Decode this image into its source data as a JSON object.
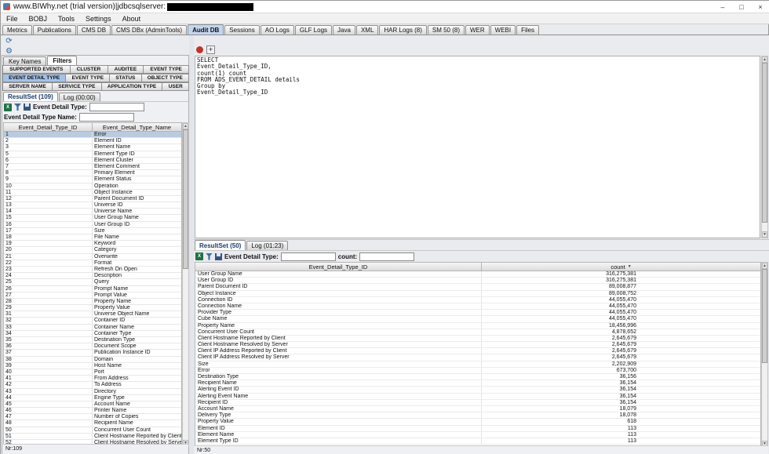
{
  "window": {
    "title": "www.BIWhy.net (trial version)|jdbcsqlserver:",
    "status_hidden": "redacted"
  },
  "icons": {
    "minimize": "–",
    "maximize": "□",
    "close": "×",
    "refresh": "⟳",
    "settings": "⚙",
    "add": "+",
    "excel": "X",
    "scroll_up": "▲",
    "scroll_down": "▼",
    "sort_desc": "▼"
  },
  "menu": {
    "items": [
      {
        "label": "File"
      },
      {
        "label": "BOBJ"
      },
      {
        "label": "Tools"
      },
      {
        "label": "Settings"
      },
      {
        "label": "About"
      }
    ]
  },
  "main_tabs": {
    "items": [
      {
        "label": "Metrics"
      },
      {
        "label": "Publications"
      },
      {
        "label": "CMS DB"
      },
      {
        "label": "CMS DBx (AdminTools)"
      },
      {
        "label": "Audit DB",
        "selected": true
      },
      {
        "label": "Sessions"
      },
      {
        "label": "AO Logs"
      },
      {
        "label": "GLF Logs"
      },
      {
        "label": "Java"
      },
      {
        "label": "XML"
      },
      {
        "label": "HAR Logs (8)"
      },
      {
        "label": "SM 50 (8)"
      },
      {
        "label": "WER"
      },
      {
        "label": "WEBI"
      },
      {
        "label": "Files"
      }
    ]
  },
  "left_panel": {
    "tabs": [
      {
        "label": "Key Names"
      },
      {
        "label": "Filters",
        "selected": true
      }
    ],
    "filter_tabs_row1": [
      {
        "label": "SUPPORTED EVENTS"
      },
      {
        "label": "CLUSTER"
      },
      {
        "label": "AUDITEE"
      },
      {
        "label": "EVENT TYPE"
      }
    ],
    "filter_tabs_row2": [
      {
        "label": "EVENT DETAIL TYPE",
        "selected": true
      },
      {
        "label": "EVENT TYPE"
      },
      {
        "label": "STATUS"
      },
      {
        "label": "OBJECT TYPE"
      }
    ],
    "filter_tabs_row3": [
      {
        "label": "SERVER NAME"
      },
      {
        "label": "SERVICE TYPE"
      },
      {
        "label": "APPLICATION TYPE"
      },
      {
        "label": "USER"
      }
    ],
    "result_tabs": [
      {
        "label": "ResultSet (109)",
        "selected": true
      },
      {
        "label": "Log (00:00)"
      }
    ],
    "filter_label": "Event Detail Type:",
    "filter_value": "",
    "name_label": "Event Detail Type Name:",
    "name_value": "",
    "table": {
      "col1": "Event_Detail_Type_ID",
      "col2": "Event_Detail_Type_Name",
      "selected_row": 0,
      "rows": [
        [
          "1",
          "Error"
        ],
        [
          "2",
          "Element ID"
        ],
        [
          "3",
          "Element Name"
        ],
        [
          "5",
          "Element Type ID"
        ],
        [
          "6",
          "Element Cluster"
        ],
        [
          "7",
          "Element Comment"
        ],
        [
          "8",
          "Primary Element"
        ],
        [
          "9",
          "Element Status"
        ],
        [
          "10",
          "Operation"
        ],
        [
          "11",
          "Object Instance"
        ],
        [
          "12",
          "Parent Document ID"
        ],
        [
          "13",
          "Universe ID"
        ],
        [
          "14",
          "Universe Name"
        ],
        [
          "15",
          "User Group Name"
        ],
        [
          "16",
          "User Group ID"
        ],
        [
          "17",
          "Size"
        ],
        [
          "18",
          "File Name"
        ],
        [
          "19",
          "Keyword"
        ],
        [
          "20",
          "Category"
        ],
        [
          "21",
          "Overwrite"
        ],
        [
          "22",
          "Format"
        ],
        [
          "23",
          "Refresh On Open"
        ],
        [
          "24",
          "Description"
        ],
        [
          "25",
          "Query"
        ],
        [
          "26",
          "Prompt Name"
        ],
        [
          "27",
          "Prompt Value"
        ],
        [
          "28",
          "Property Name"
        ],
        [
          "29",
          "Property Value"
        ],
        [
          "31",
          "Universe Object Name"
        ],
        [
          "32",
          "Container ID"
        ],
        [
          "33",
          "Container Name"
        ],
        [
          "34",
          "Container Type"
        ],
        [
          "35",
          "Destination Type"
        ],
        [
          "36",
          "Document Scope"
        ],
        [
          "37",
          "Publication Instance ID"
        ],
        [
          "38",
          "Domain"
        ],
        [
          "39",
          "Host Name"
        ],
        [
          "40",
          "Port"
        ],
        [
          "41",
          "From Address"
        ],
        [
          "42",
          "To Address"
        ],
        [
          "43",
          "Directory"
        ],
        [
          "44",
          "Engine Type"
        ],
        [
          "45",
          "Account Name"
        ],
        [
          "46",
          "Printer Name"
        ],
        [
          "47",
          "Number of Copies"
        ],
        [
          "48",
          "Recipient Name"
        ],
        [
          "50",
          "Concurrent User Count"
        ],
        [
          "51",
          "Client Hostname Reported by Client"
        ],
        [
          "52",
          "Client Hostname Resolved by Server"
        ]
      ]
    },
    "status": "Nr:109"
  },
  "sql_editor": {
    "lines": [
      "SELECT",
      "Event_Detail_Type_ID,",
      "count(1) count",
      "FROM ADS_EVENT_DETAIL details",
      "Group by",
      "Event_Detail_Type_ID"
    ]
  },
  "bottom_panel": {
    "tabs": [
      {
        "label": "ResultSet (50)",
        "selected": true
      },
      {
        "label": "Log (01:23)"
      }
    ],
    "filter_label": "Event Detail Type:",
    "filter_value": "",
    "count_label": "count:",
    "count_value": "",
    "table": {
      "col1": "Event_Detail_Type_ID",
      "col2": "count",
      "rows": [
        [
          "User Group Name",
          "316,275,381"
        ],
        [
          "User Group ID",
          "316,275,381"
        ],
        [
          "Parent Document ID",
          "89,008,877"
        ],
        [
          "Object Instance",
          "89,008,752"
        ],
        [
          "Connection ID",
          "44,055,470"
        ],
        [
          "Connection Name",
          "44,055,470"
        ],
        [
          "Provider Type",
          "44,055,470"
        ],
        [
          "Cube Name",
          "44,055,470"
        ],
        [
          "Property Name",
          "18,456,996"
        ],
        [
          "Concurrent User Count",
          "4,878,652"
        ],
        [
          "Client Hostname Reported by Client",
          "2,645,679"
        ],
        [
          "Client Hostname Resolved by Server",
          "2,645,679"
        ],
        [
          "Client IP Address Reported by Client",
          "2,645,679"
        ],
        [
          "Client IP Address Resolved by Server",
          "2,645,679"
        ],
        [
          "Size",
          "2,202,909"
        ],
        [
          "Error",
          "673,700"
        ],
        [
          "Destination Type",
          "36,156"
        ],
        [
          "Recipient Name",
          "36,154"
        ],
        [
          "Alerting Event ID",
          "36,154"
        ],
        [
          "Alerting Event Name",
          "36,154"
        ],
        [
          "Recipient ID",
          "36,154"
        ],
        [
          "Account Name",
          "18,079"
        ],
        [
          "Delivery Type",
          "18,078"
        ],
        [
          "Property Value",
          "618"
        ],
        [
          "Element ID",
          "113"
        ],
        [
          "Element Name",
          "113"
        ],
        [
          "Element Type ID",
          "113"
        ]
      ]
    },
    "status": "Nr:50"
  }
}
